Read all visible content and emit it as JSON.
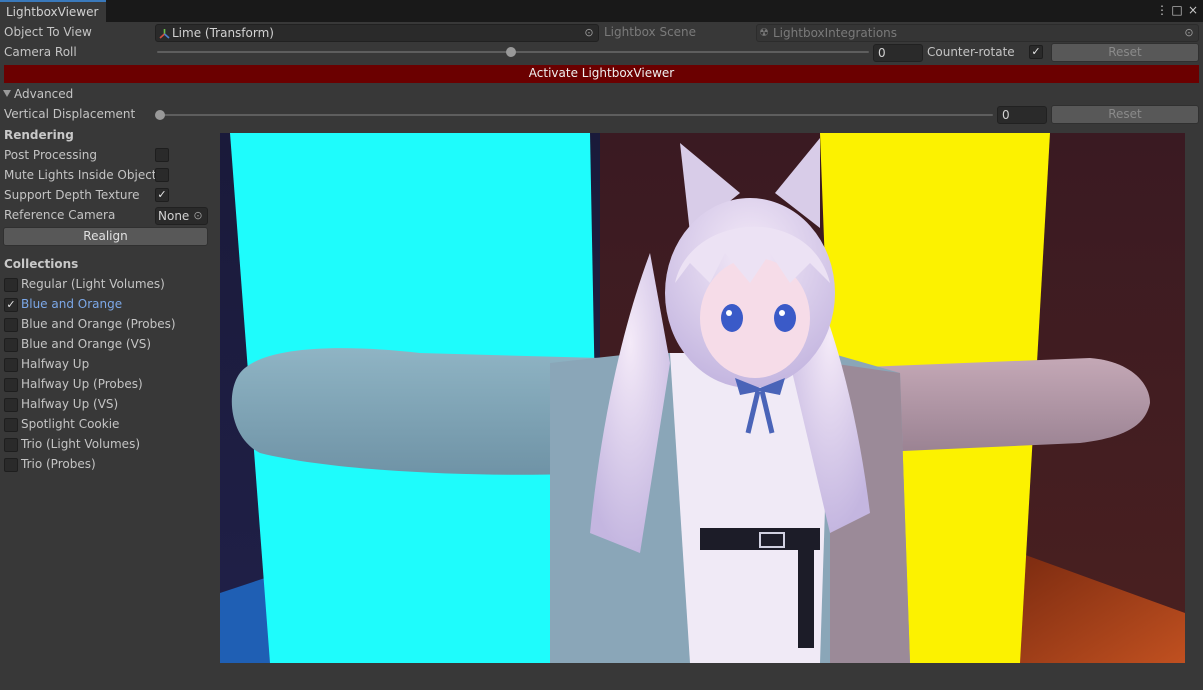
{
  "window": {
    "tab_title": "LightboxViewer",
    "controls": [
      "⋮",
      "□",
      "×"
    ]
  },
  "object_to_view": {
    "label": "Object To View",
    "value": "Lime (Transform)",
    "scene_placeholder": "Lightbox Scene",
    "integrations_placeholder": "LightboxIntegrations"
  },
  "camera_roll": {
    "label": "Camera Roll",
    "value": "0",
    "slider_level": 0.5,
    "counter_rotate_label": "Counter-rotate",
    "counter_rotate_checked": true,
    "reset_label": "Reset"
  },
  "activate_button": "Activate LightboxViewer",
  "advanced": {
    "label": "Advanced",
    "vertical_displacement_label": "Vertical Displacement",
    "vertical_displacement_value": "0",
    "slider_level": 0.0,
    "reset_label": "Reset"
  },
  "rendering": {
    "header": "Rendering",
    "options": [
      {
        "label": "Post Processing",
        "checked": false
      },
      {
        "label": "Mute Lights Inside Object",
        "checked": false
      },
      {
        "label": "Support Depth Texture",
        "checked": true
      }
    ],
    "reference_camera_label": "Reference Camera",
    "reference_camera_value": "None",
    "realign_label": "Realign"
  },
  "collections": {
    "header": "Collections",
    "items": [
      {
        "label": "Regular (Light Volumes)",
        "checked": false
      },
      {
        "label": "Blue and Orange",
        "checked": true
      },
      {
        "label": "Blue and Orange (Probes)",
        "checked": false
      },
      {
        "label": "Blue and Orange (VS)",
        "checked": false
      },
      {
        "label": "Halfway Up",
        "checked": false
      },
      {
        "label": "Halfway Up (Probes)",
        "checked": false
      },
      {
        "label": "Halfway Up (VS)",
        "checked": false
      },
      {
        "label": "Spotlight Cookie",
        "checked": false
      },
      {
        "label": "Trio (Light Volumes)",
        "checked": false
      },
      {
        "label": "Trio (Probes)",
        "checked": false
      }
    ]
  },
  "colors": {
    "accent": "#3a79bb",
    "activate_bar": "#6b0000",
    "selected_text": "#7ca8e8",
    "cyan_light": "#1efcfc",
    "yellow_light": "#fcf200"
  }
}
